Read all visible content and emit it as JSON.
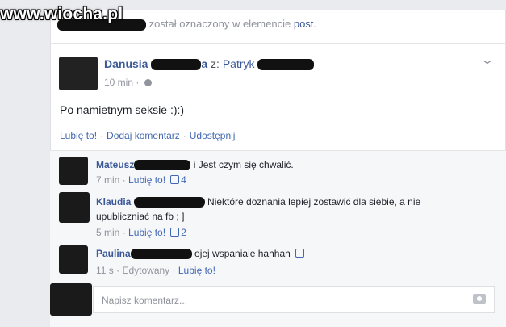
{
  "watermark": "www.wiocha.pl",
  "topline": {
    "text": "został oznaczony w elemencie",
    "link": "post",
    "period": "."
  },
  "post": {
    "author_first": "Danusia",
    "author_tail": "a",
    "with": "z:",
    "friend_first": "Patryk",
    "time": "10 min",
    "separator": "·",
    "text": "Po namietnym seksie :):)",
    "actions": [
      "Lubię to!",
      "Dodaj komentarz",
      "Udostępnij"
    ]
  },
  "comments": [
    {
      "name": "Mateusz",
      "text": "i Jest czym się chwalić.",
      "time": "7 min",
      "like": "Lubię to!",
      "likes": "4"
    },
    {
      "name": "Klaudia",
      "text": "Niektóre doznania lepiej zostawić dla siebie, a nie",
      "text2": "upubliczniać na fb ; ]",
      "time": "5 min",
      "like": "Lubię to!",
      "likes": "2"
    },
    {
      "name": "Paulina",
      "text": "ojej wspaniale hahhah",
      "time": "11 s",
      "edited": "Edytowany",
      "like": "Lubię to!"
    }
  ],
  "composer": {
    "placeholder": "Napisz komentarz..."
  },
  "icons": {
    "globe": "globe-icon",
    "chevron": "chevron-down-icon",
    "thumb": "thumbs-up-icon",
    "camera": "camera-icon"
  },
  "colors": {
    "link": "#3b5998",
    "action": "#4267b2",
    "meta": "#90949c",
    "background": "#e9ebee"
  }
}
